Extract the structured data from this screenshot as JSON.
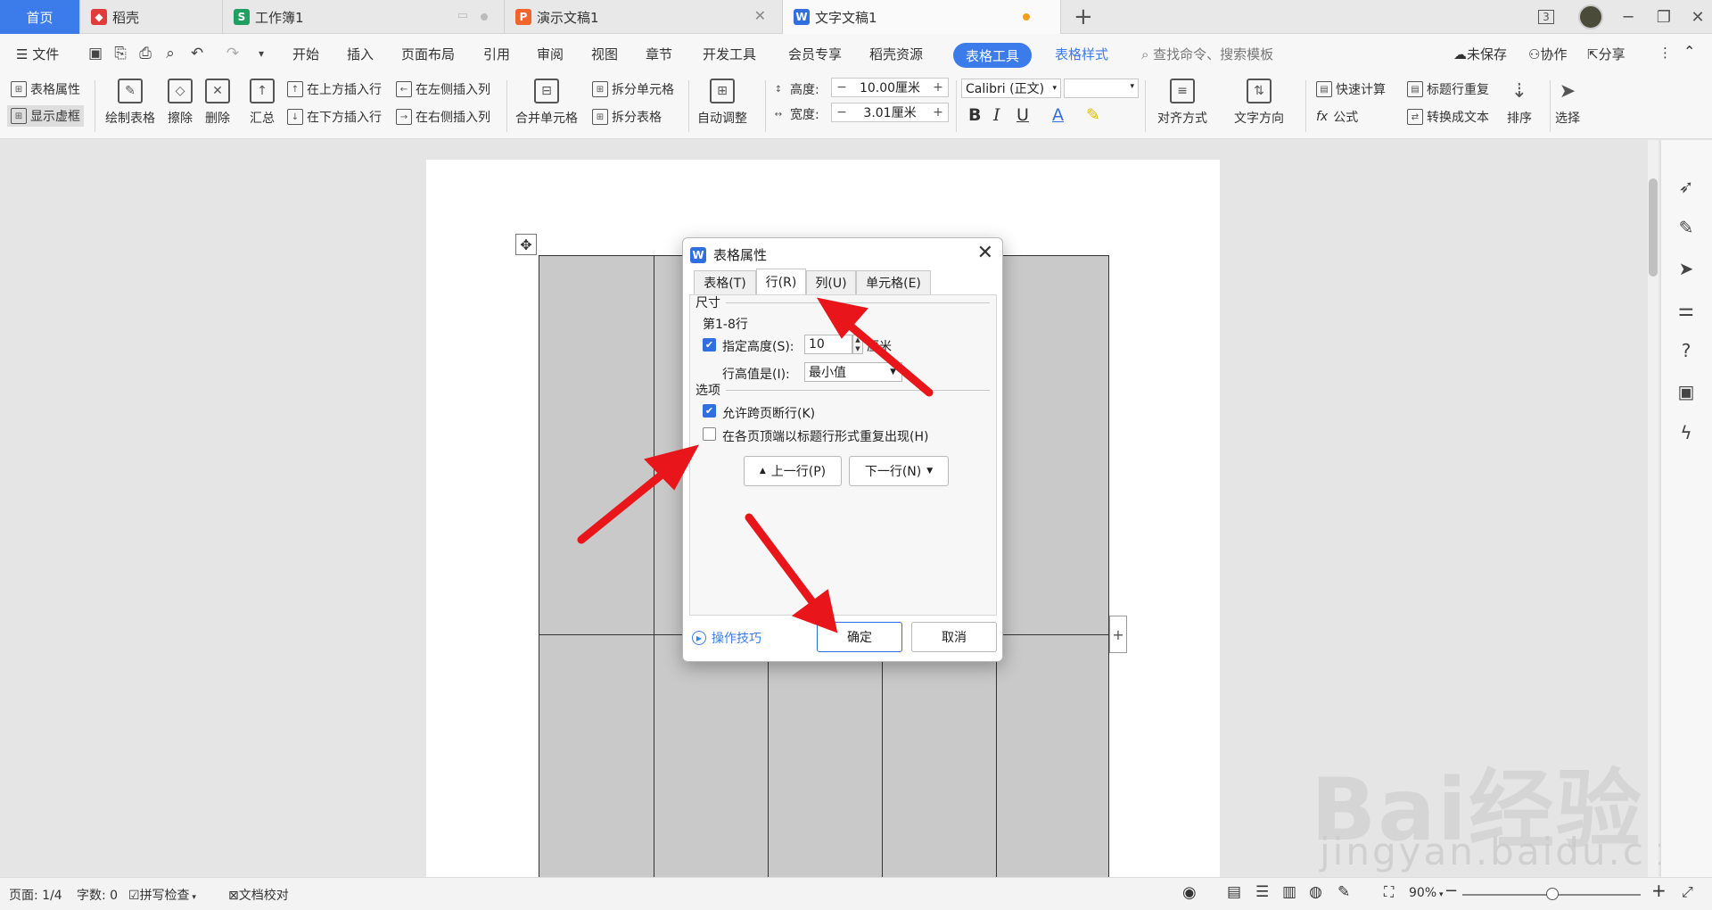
{
  "tabs": {
    "home": "首页",
    "daoke": "稻壳",
    "sheet": "工作簿1",
    "ppt": "演示文稿1",
    "doc": "文字文稿1",
    "badge": "3"
  },
  "menu": {
    "file": "文件",
    "items": [
      "开始",
      "插入",
      "页面布局",
      "引用",
      "审阅",
      "视图",
      "章节",
      "开发工具",
      "会员专享",
      "稻壳资源"
    ],
    "table_tools": "表格工具",
    "table_style": "表格样式",
    "search": "查找命令、搜索模板",
    "unsaved": "未保存",
    "collab": "协作",
    "share": "分享"
  },
  "ribbon": {
    "table_props": "表格属性",
    "show_grid": "显示虚框",
    "draw_table": "绘制表格",
    "erase": "擦除",
    "delete": "删除",
    "summary": "汇总",
    "insert_above": "在上方插入行",
    "insert_below": "在下方插入行",
    "insert_left": "在左侧插入列",
    "insert_right": "在右侧插入列",
    "merge": "合并单元格",
    "split_cells": "拆分单元格",
    "split_table": "拆分表格",
    "auto_fit": "自动调整",
    "height_label": "高度:",
    "height_value": "10.00厘米",
    "width_label": "宽度:",
    "width_value": "3.01厘米",
    "font": "Calibri (正文)",
    "align": "对齐方式",
    "text_dir": "文字方向",
    "quick_calc": "快速计算",
    "formula": "公式",
    "title_repeat": "标题行重复",
    "to_text": "转换成文本",
    "sort": "排序",
    "select": "选择"
  },
  "dialog": {
    "title": "表格属性",
    "tabs": [
      "表格(T)",
      "行(R)",
      "列(U)",
      "单元格(E)"
    ],
    "size_group": "尺寸",
    "rows_label": "第1-8行",
    "specify_height": "指定高度(S):",
    "height_value": "10",
    "height_unit": "厘米",
    "row_height_is": "行高值是(I):",
    "row_height_mode": "最小值",
    "options_group": "选项",
    "allow_break": "允许跨页断行(K)",
    "repeat_header": "在各页顶端以标题行形式重复出现(H)",
    "prev_row": "上一行(P)",
    "next_row": "下一行(N)",
    "tips": "操作技巧",
    "ok": "确定",
    "cancel": "取消",
    "specify_height_checked": true,
    "allow_break_checked": true,
    "repeat_header_checked": false
  },
  "status": {
    "page": "页面: 1/4",
    "words": "字数: 0",
    "spell": "拼写检查",
    "doc_check": "文档校对",
    "zoom": "90%"
  },
  "watermark": {
    "logo": "Bai经验",
    "url": "jingyan.baidu.com"
  },
  "colors": {
    "accent": "#3c7bea",
    "arrow": "#e8161b"
  }
}
